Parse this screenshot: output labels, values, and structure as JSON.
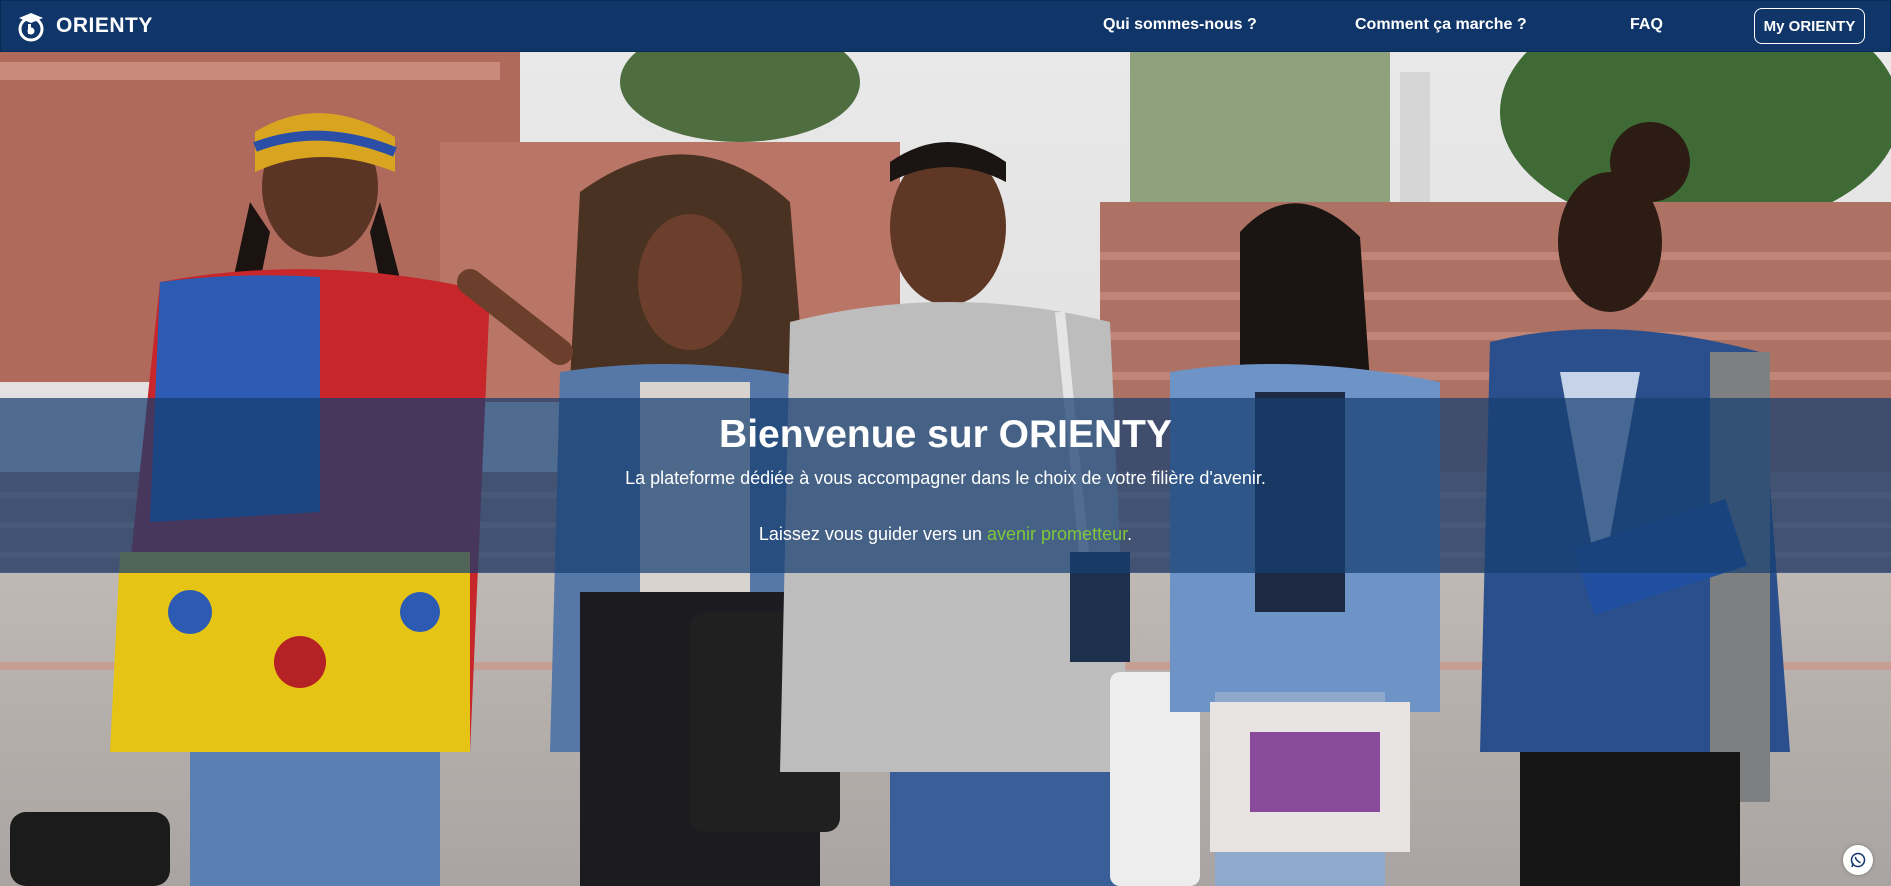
{
  "navbar": {
    "brand": "ORIENTY",
    "links": {
      "qui": "Qui sommes-nous ?",
      "comment": "Comment ça marche ?",
      "faq": "FAQ",
      "my_orienty": "My ORIENTY"
    },
    "background_color": "#0f3569"
  },
  "hero": {
    "title": "Bienvenue sur ORIENTY",
    "subtitle": "La plateforme dédiée à vous accompagner dans le choix de votre filière d'avenir.",
    "tagline_prefix": "Laissez vous guider vers un ",
    "tagline_highlight": "avenir prometteur",
    "tagline_suffix": ".",
    "highlight_color": "#7ec83a",
    "background_image": "group-of-students-photo"
  },
  "floating_button": {
    "icon": "whatsapp-icon"
  }
}
